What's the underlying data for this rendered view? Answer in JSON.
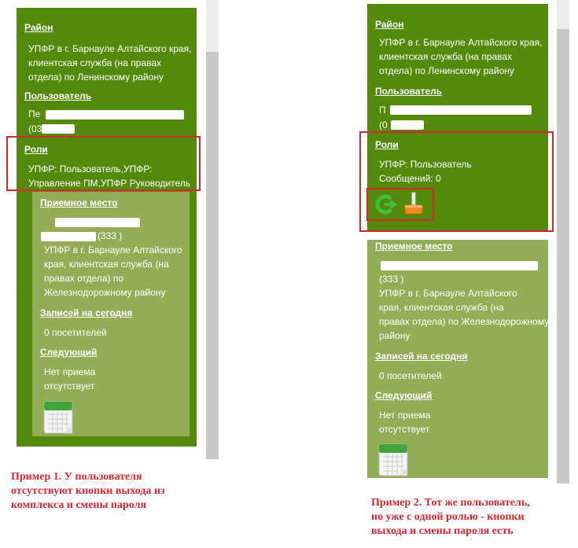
{
  "left": {
    "district_header": "Район",
    "district_text": "УПФР в г. Барнауле Алтайского края,\nклиентская служба (на правах\nотдела) по Ленинскому району",
    "user_header": "Пользователь",
    "user_line1": "Пе",
    "user_line2": "(03",
    "roles_header": "Роли",
    "roles_text": "УПФР: Пользователь,УПФР:\nУправление ПМ,УПФР Руководитель",
    "reception_header": "Приемное место",
    "reception_line1": "",
    "reception_line2": "(333 )",
    "reception_text": "УПФР в г. Барнауле Алтайского\nкрая, клиентская служба (на\nправах отдела) по\nЖелезнодорожному району",
    "records_header": "Записей на сегодня",
    "records_text": "0 посетителей",
    "next_header": "Следующий",
    "next_text": "Нет приема\nотсутствует"
  },
  "right": {
    "district_header": "Район",
    "district_text": "УПФР в г. Барнауле Алтайского края,\nклиентская служба (на правах\nотдела) по Ленинскому району",
    "user_header": "Пользователь",
    "user_line1": "П",
    "user_line2": "(0",
    "roles_header": "Роли",
    "roles_text": "УПФР: Пользователь\nСообщений: 0",
    "reception_header": "Приемное место",
    "reception_line1": "",
    "reception_line2": "(333 )",
    "reception_text": "УПФР в г. Барнауле Алтайского\nкрая, клиентская служба (на\nправах отдела) по Железнодорожному\nрайону",
    "records_header": "Записей на сегодня",
    "records_text": "0 посетителей",
    "next_header": "Следующий",
    "next_text": "Нет приема\nотсутствует"
  },
  "captions": {
    "example1": "Пример 1. У пользователя\nотсутствуют кнопки выхода из\nкомплекса и смены пароля",
    "example2": "Пример 2. Тот же пользователь,\nно уже с одной ролью - кнопки\nвыхода и смены пароля есть"
  },
  "icons": {
    "logout": "logout-icon",
    "change_password": "change-password-icon",
    "calendar": "calendar-icon"
  },
  "colors": {
    "panel_green": "#548a0c",
    "sub_green": "#93ad57",
    "annotation_red": "#d8262e"
  }
}
